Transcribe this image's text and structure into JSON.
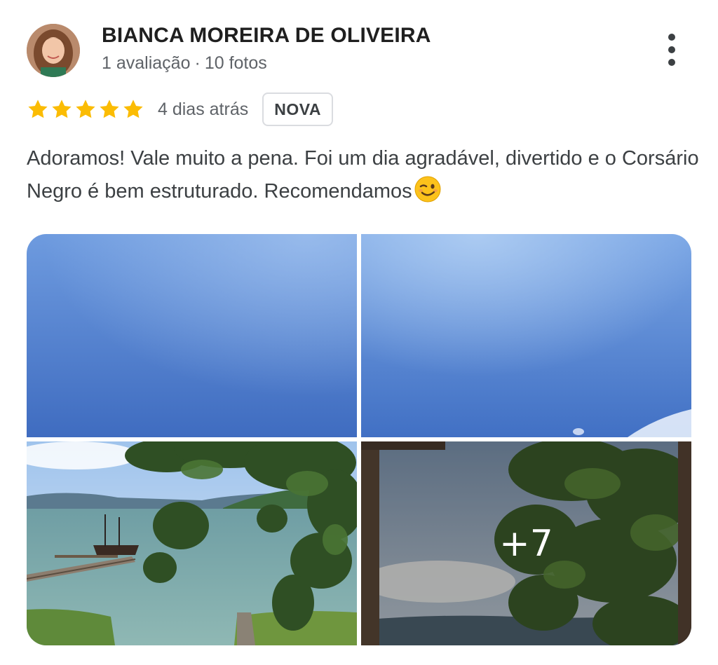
{
  "reviewer": {
    "name": "BIANCA MOREIRA DE OLIVEIRA",
    "reviews_count": "1 avaliação",
    "separator": "·",
    "photos_count": "10 fotos",
    "avatar_icon": "avatar-photo"
  },
  "review": {
    "rating": 5,
    "max_rating": 5,
    "star_color": "#fbbc04",
    "date": "4 dias atrás",
    "badge": "NOVA",
    "text": "Adoramos! Vale muito a pena. Foi um dia agradável, divertido e o Corsário Negro é bem estruturado. Recomendamos",
    "emoji_icon": "winking-face-icon"
  },
  "menu_icon": "more-vert-icon",
  "gallery": {
    "photos": [
      {
        "icon": "sky-photo"
      },
      {
        "icon": "sky-clouds-photo"
      },
      {
        "icon": "bay-pirate-ship-photo"
      },
      {
        "icon": "tree-view-photo"
      }
    ],
    "more_label": "+7"
  }
}
